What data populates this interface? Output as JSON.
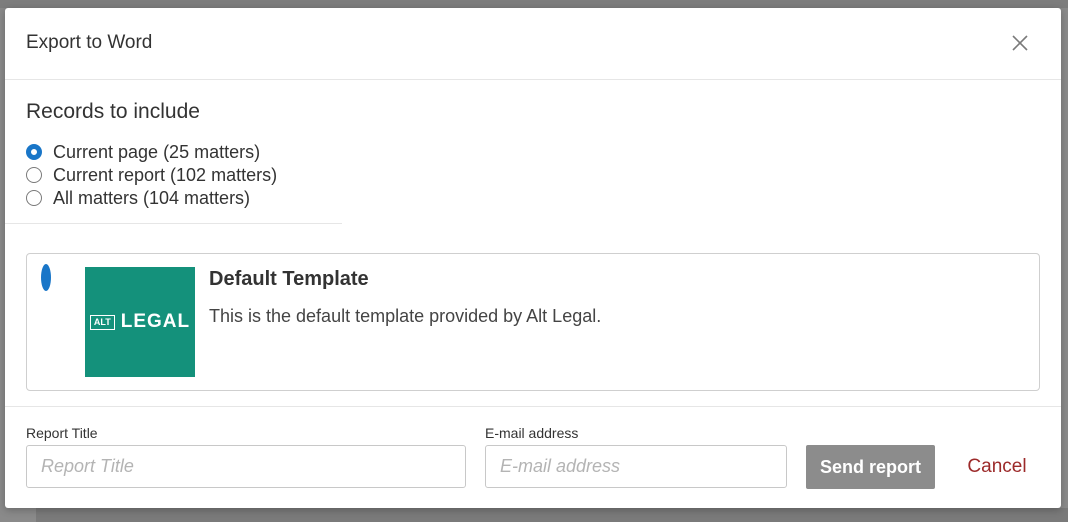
{
  "modal": {
    "title": "Export to Word"
  },
  "records": {
    "title": "Records to include",
    "options": [
      {
        "label": "Current page (25 matters)",
        "checked": true
      },
      {
        "label": "Current report (102 matters)",
        "checked": false
      },
      {
        "label": "All matters (104 matters)",
        "checked": false
      }
    ]
  },
  "template": {
    "logo_box_text": "ALT",
    "logo_word": "LEGAL",
    "name": "Default Template",
    "description": "This is the default template provided by Alt Legal.",
    "selected": true
  },
  "form": {
    "report_title_label": "Report Title",
    "report_title_placeholder": "Report Title",
    "report_title_value": "",
    "email_label": "E-mail address",
    "email_placeholder": "E-mail address",
    "email_value": "",
    "send_label": "Send report",
    "cancel_label": "Cancel"
  },
  "icons": {
    "close": "close-icon",
    "radio": "radio-icon"
  },
  "colors": {
    "accent": "#1976c8",
    "logo_bg": "#14917b",
    "send_bg": "#8c8c8c",
    "cancel_text": "#9c2a2a"
  }
}
